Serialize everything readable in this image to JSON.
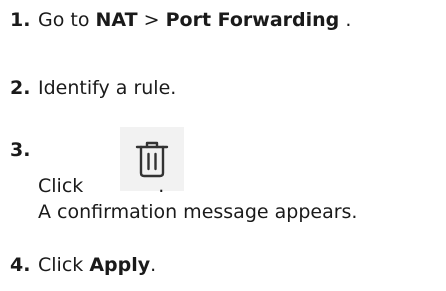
{
  "steps": [
    {
      "number": "1.",
      "prefix": "Go to ",
      "nav_first": "NAT",
      "separator": " > ",
      "nav_second": "Port Forwarding",
      "suffix": " ."
    },
    {
      "number": "2.",
      "text": "Identify a rule."
    },
    {
      "number": "3.",
      "click_text": "Click",
      "after_icon": ".",
      "icon": "trash-icon",
      "result": "A confirmation message appears."
    },
    {
      "number": "4.",
      "prefix": "Click ",
      "action": "Apply",
      "suffix": "."
    }
  ]
}
